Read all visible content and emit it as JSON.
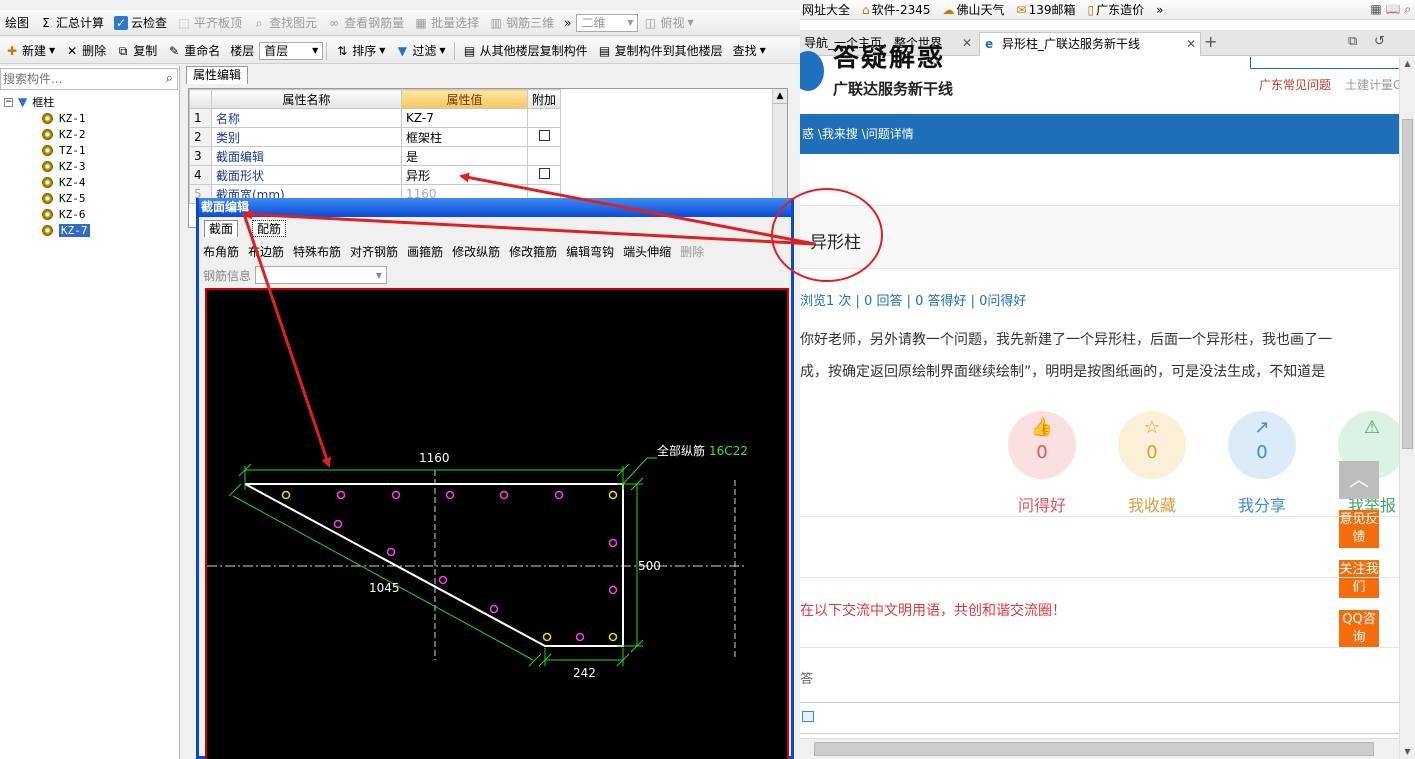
{
  "app": {
    "toolbar1": {
      "draw": "绘图",
      "sum": "汇总计算",
      "cloud_check": "云检查",
      "align_slab": "平齐板顶",
      "find_figure": "查找图元",
      "view_rebar": "查看钢筋量",
      "batch_select": "批量选择",
      "rebar_3d": "钢筋三维",
      "more": "»",
      "view_2d": "二维",
      "view_top": "俯视"
    },
    "toolbar2": {
      "new": "新建",
      "delete": "删除",
      "copy": "复制",
      "rename": "重命名",
      "floor_label": "楼层",
      "floor_value": "首层",
      "sort": "排序",
      "filter": "过滤",
      "copy_from_floor": "从其他楼层复制构件",
      "copy_to_floor": "复制构件到其他楼层",
      "find": "查找"
    },
    "search_placeholder": "搜索构件...",
    "tree": {
      "root": "框柱",
      "items": [
        "KZ-1",
        "KZ-2",
        "TZ-1",
        "KZ-3",
        "KZ-4",
        "KZ-5",
        "KZ-6",
        "KZ-7"
      ]
    },
    "prop_tab": "属性编辑",
    "prop_headers": {
      "name": "属性名称",
      "value": "属性值",
      "extra": "附加"
    },
    "prop_rows": [
      {
        "num": "1",
        "name": "名称",
        "value": "KZ-7"
      },
      {
        "num": "2",
        "name": "类别",
        "value": "框架柱"
      },
      {
        "num": "3",
        "name": "截面编辑",
        "value": "是"
      },
      {
        "num": "4",
        "name": "截面形状",
        "value": "异形"
      },
      {
        "num": "5",
        "name": "截面宽(mm)",
        "value": "1160"
      }
    ],
    "dialog": {
      "title": "截面编辑",
      "tab_section": "截面",
      "tab_rebar": "配筋",
      "tools": [
        "布角筋",
        "布边筋",
        "特殊布筋",
        "对齐钢筋",
        "画箍筋",
        "修改纵筋",
        "修改箍筋",
        "编辑弯钩",
        "端头伸缩",
        "删除"
      ],
      "rebar_info_label": "钢筋信息",
      "drawing": {
        "dim_top": "1160",
        "dim_right": "500",
        "dim_bottom": "242",
        "dim_diag": "1045",
        "label_all": "全部纵筋",
        "label_spec": "16C22"
      }
    }
  },
  "browser": {
    "bookmarks": [
      "网址大全",
      "软件-2345",
      "佛山天气",
      "139邮箱",
      "广东造价",
      "»"
    ],
    "tabs": [
      {
        "title": "导航_一个主页，整个世界"
      },
      {
        "title": "异形柱_广联达服务新干线"
      }
    ],
    "new_tab": "+",
    "site_logo": "答疑解惑",
    "site_subtitle": "广联达服务新干线",
    "header_links": [
      "广东常见问题",
      "土建计量G"
    ],
    "breadcrumb": "惑 \\我来搜 \\问题详情",
    "question_title": "异形柱",
    "question_stats": "浏览1 次 | 0 回答 | 0 答得好 | 0问得好",
    "question_body_line1": "你好老师，另外请教一个问题，我先新建了一个异形柱，后面一个异形柱，我也画了一",
    "question_body_line2": "成，按确定返回原绘制界面继续绘制”，明明是按图纸画的，可是没法生成，不知道是",
    "actions": [
      {
        "label": "问得好",
        "count": "0",
        "color": "#e0555e",
        "bg": "#fbe0e2"
      },
      {
        "label": "我收藏",
        "count": "0",
        "color": "#d3a040",
        "bg": "#fcefd8"
      },
      {
        "label": "我分享",
        "count": "0",
        "color": "#3c8ccf",
        "bg": "#dcebf8"
      },
      {
        "label": "我举报",
        "count": "",
        "color": "#41a86a",
        "bg": "#dcf2e4"
      }
    ],
    "side_buttons": [
      "意见反馈",
      "关注我们",
      "QQ咨询"
    ],
    "notice": "在以下交流中文明用语，共创和谐交流圈！",
    "bottom_frag": "答"
  },
  "annotation": {
    "color": "#e02020"
  }
}
